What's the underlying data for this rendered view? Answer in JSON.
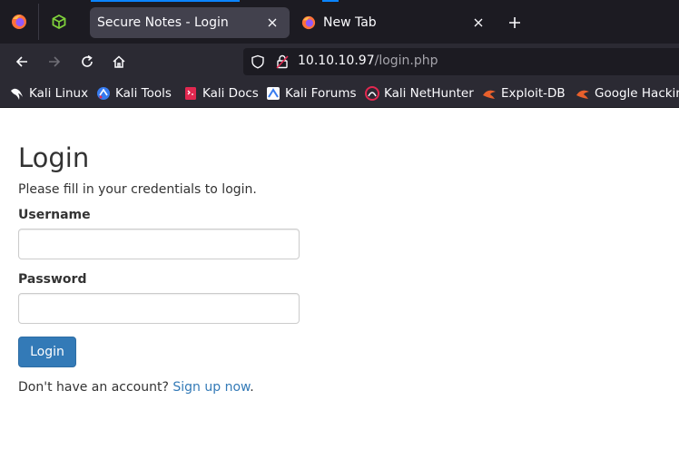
{
  "browser": {
    "tabs": [
      {
        "title": "Secure Notes - Login",
        "active": true
      },
      {
        "title": "New Tab",
        "active": false
      }
    ],
    "url": {
      "host": "10.10.10.97",
      "path": "/login.php"
    },
    "bookmarks": [
      {
        "label": "Kali Linux",
        "icon": "kali-dragon-icon"
      },
      {
        "label": "Kali Tools",
        "icon": "kali-tools-icon"
      },
      {
        "label": "Kali Docs",
        "icon": "kali-docs-icon"
      },
      {
        "label": "Kali Forums",
        "icon": "kali-forums-icon"
      },
      {
        "label": "Kali NetHunter",
        "icon": "nethunter-icon"
      },
      {
        "label": "Exploit-DB",
        "icon": "exploitdb-icon"
      },
      {
        "label": "Google Hacking DB",
        "icon": "ghdb-icon"
      }
    ],
    "colors": {
      "accent": "#0a84ff",
      "tabbar": "#1c1b22",
      "toolbar": "#2b2a33"
    }
  },
  "page": {
    "title": "Login",
    "intro": "Please fill in your credentials to login.",
    "username_label": "Username",
    "username_value": "",
    "password_label": "Password",
    "password_value": "",
    "submit_label": "Login",
    "signup_prefix": "Don't have an account? ",
    "signup_link": "Sign up now",
    "signup_suffix": ".",
    "colors": {
      "primary": "#337ab7",
      "text": "#333333"
    }
  }
}
